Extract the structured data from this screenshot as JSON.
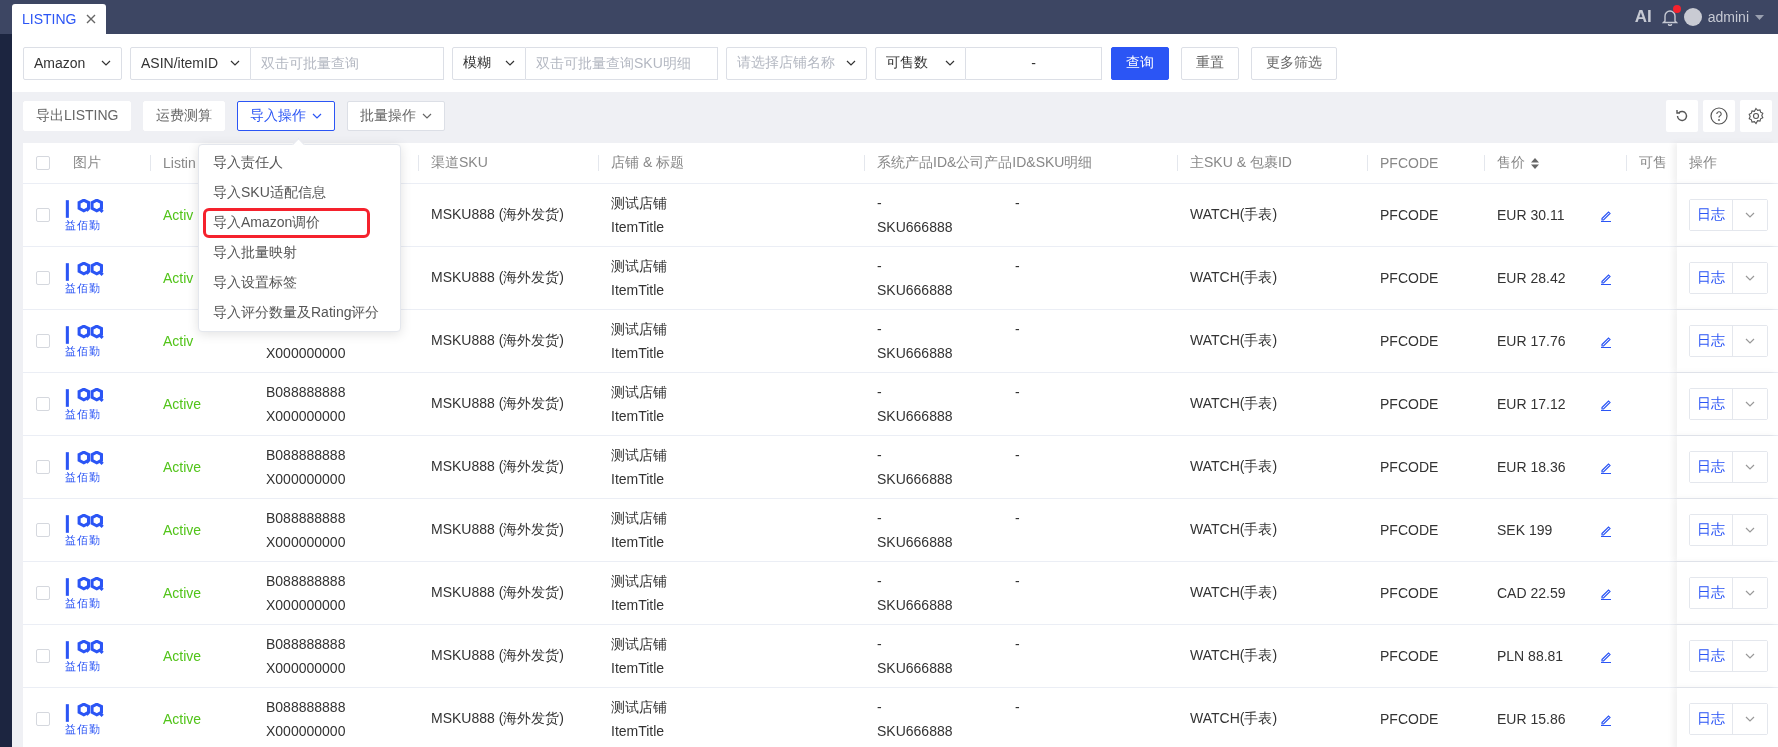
{
  "header": {
    "tab": {
      "label": "LISTING",
      "selected": true
    },
    "ai_label": "AI",
    "notification_dot": true,
    "user": "admini"
  },
  "filters": {
    "platform": "Amazon",
    "id_type": "ASIN/itemID",
    "id_placeholder": "双击可批量查询",
    "match_mode": "模糊",
    "sku_placeholder": "双击可批量查询SKU明细",
    "store_placeholder": "请选择店铺名称",
    "qty_type": "可售数",
    "qty_separator": "-",
    "search": "查询",
    "reset": "重置",
    "more": "更多筛选"
  },
  "toolbar": {
    "buttons": [
      {
        "label": "导出LISTING",
        "kind": "plain"
      },
      {
        "label": "运费测算",
        "kind": "plain"
      },
      {
        "label": "导入操作",
        "kind": "dropdown",
        "selected": true
      },
      {
        "label": "批量操作",
        "kind": "dropdown",
        "selected": false
      }
    ]
  },
  "import_menu": {
    "items": [
      {
        "label": "导入责任人",
        "highlighted": false
      },
      {
        "label": "导入SKU适配信息",
        "highlighted": false
      },
      {
        "label": "导入Amazon调价",
        "highlighted": true
      },
      {
        "label": "导入批量映射",
        "highlighted": false
      },
      {
        "label": "导入设置标签",
        "highlighted": false
      },
      {
        "label": "导入评分数量及Rating评分",
        "highlighted": false
      }
    ]
  },
  "table": {
    "columns": [
      {
        "kind": "check",
        "checked": false
      },
      {
        "kind": "text",
        "label": "图片"
      },
      {
        "kind": "text",
        "label": "Listin"
      },
      {
        "kind": "hidden"
      },
      {
        "kind": "text",
        "label": "渠道SKU"
      },
      {
        "kind": "text",
        "label": "店铺 & 标题"
      },
      {
        "kind": "text",
        "label": "系统产品ID&公司产品ID&SKU明细"
      },
      {
        "kind": "text",
        "label": "主SKU & 包裹ID"
      },
      {
        "kind": "text",
        "label": "PFCODE"
      },
      {
        "kind": "sort",
        "label": "售价"
      },
      {
        "kind": "text",
        "label": "可售"
      },
      {
        "kind": "text",
        "label": "操作"
      }
    ],
    "rows": [
      {
        "checked": false,
        "logo_text": "益佰勤",
        "status": "Activ",
        "channel_sku": "MSKU888 (海外发货)",
        "store": "测试店铺",
        "title": "ItemTitle",
        "system_id": "-",
        "sku_detail": "SKU666888",
        "company_id": "-",
        "main_sku": "WATCH(手表)",
        "pfcode": "PFCODE",
        "price": "EUR 30.11",
        "action": "日志"
      },
      {
        "checked": false,
        "logo_text": "益佰勤",
        "status": "Activ",
        "channel_sku": "MSKU888 (海外发货)",
        "store": "测试店铺",
        "title": "ItemTitle",
        "system_id": "-",
        "sku_detail": "SKU666888",
        "company_id": "-",
        "main_sku": "WATCH(手表)",
        "pfcode": "PFCODE",
        "price": "EUR 28.42",
        "action": "日志"
      },
      {
        "checked": false,
        "logo_text": "益佰勤",
        "status": "Activ",
        "asin_2": "X000000000",
        "channel_sku": "MSKU888 (海外发货)",
        "store": "测试店铺",
        "title": "ItemTitle",
        "system_id": "-",
        "sku_detail": "SKU666888",
        "company_id": "-",
        "main_sku": "WATCH(手表)",
        "pfcode": "PFCODE",
        "price": "EUR 17.76",
        "action": "日志"
      },
      {
        "checked": false,
        "logo_text": "益佰勤",
        "status": "Active",
        "asin_1": "B088888888",
        "asin_2": "X000000000",
        "channel_sku": "MSKU888 (海外发货)",
        "store": "测试店铺",
        "title": "ItemTitle",
        "system_id": "-",
        "sku_detail": "SKU666888",
        "company_id": "-",
        "main_sku": "WATCH(手表)",
        "pfcode": "PFCODE",
        "price": "EUR 17.12",
        "action": "日志"
      },
      {
        "checked": false,
        "logo_text": "益佰勤",
        "status": "Active",
        "asin_1": "B088888888",
        "asin_2": "X000000000",
        "channel_sku": "MSKU888 (海外发货)",
        "store": "测试店铺",
        "title": "ItemTitle",
        "system_id": "-",
        "sku_detail": "SKU666888",
        "company_id": "-",
        "main_sku": "WATCH(手表)",
        "pfcode": "PFCODE",
        "price": "EUR 18.36",
        "action": "日志"
      },
      {
        "checked": false,
        "logo_text": "益佰勤",
        "status": "Active",
        "asin_1": "B088888888",
        "asin_2": "X000000000",
        "channel_sku": "MSKU888 (海外发货)",
        "store": "测试店铺",
        "title": "ItemTitle",
        "system_id": "-",
        "sku_detail": "SKU666888",
        "company_id": "-",
        "main_sku": "WATCH(手表)",
        "pfcode": "PFCODE",
        "price": "SEK 199",
        "action": "日志"
      },
      {
        "checked": false,
        "logo_text": "益佰勤",
        "status": "Active",
        "asin_1": "B088888888",
        "asin_2": "X000000000",
        "channel_sku": "MSKU888 (海外发货)",
        "store": "测试店铺",
        "title": "ItemTitle",
        "system_id": "-",
        "sku_detail": "SKU666888",
        "company_id": "-",
        "main_sku": "WATCH(手表)",
        "pfcode": "PFCODE",
        "price": "CAD 22.59",
        "action": "日志"
      },
      {
        "checked": false,
        "logo_text": "益佰勤",
        "status": "Active",
        "asin_1": "B088888888",
        "asin_2": "X000000000",
        "channel_sku": "MSKU888 (海外发货)",
        "store": "测试店铺",
        "title": "ItemTitle",
        "system_id": "-",
        "sku_detail": "SKU666888",
        "company_id": "-",
        "main_sku": "WATCH(手表)",
        "pfcode": "PFCODE",
        "price": "PLN 88.81",
        "action": "日志"
      },
      {
        "checked": false,
        "logo_text": "益佰勤",
        "status": "Active",
        "asin_1": "B088888888",
        "asin_2": "X000000000",
        "channel_sku": "MSKU888 (海外发货)",
        "store": "测试店铺",
        "title": "ItemTitle",
        "system_id": "-",
        "sku_detail": "SKU666888",
        "company_id": "-",
        "main_sku": "WATCH(手表)",
        "pfcode": "PFCODE",
        "price": "EUR 15.86",
        "action": "日志"
      }
    ]
  }
}
